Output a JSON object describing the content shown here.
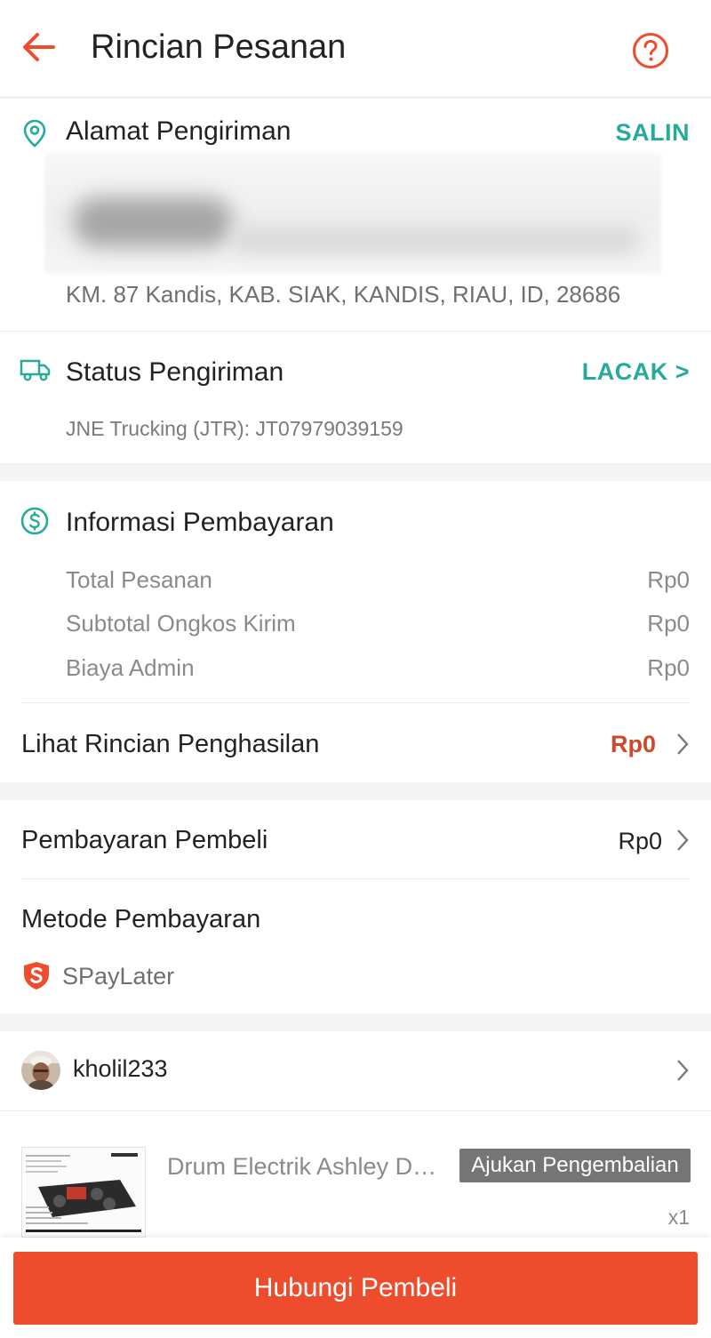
{
  "header": {
    "title": "Rincian Pesanan",
    "back_icon": "arrow-left-icon",
    "help_icon": "question-circle-icon"
  },
  "address": {
    "title": "Alamat Pengiriman",
    "copy_label": "SALIN",
    "line": "KM. 87 Kandis, KAB. SIAK, KANDIS, RIAU, ID, 28686"
  },
  "shipping": {
    "title": "Status Pengiriman",
    "track_label": "LACAK >",
    "carrier": "JNE Trucking (JTR): JT07979039159"
  },
  "payment_info": {
    "title": "Informasi Pembayaran",
    "rows": [
      {
        "label": "Total Pesanan",
        "value": "Rp0"
      },
      {
        "label": "Subtotal Ongkos Kirim",
        "value": "Rp0"
      },
      {
        "label": "Biaya Admin",
        "value": "Rp0"
      }
    ],
    "income_label": "Lihat Rincian Penghasilan",
    "income_value": "Rp0"
  },
  "buyer_payment": {
    "label": "Pembayaran Pembeli",
    "value": "Rp0",
    "method_title": "Metode Pembayaran",
    "method_name": "SPayLater"
  },
  "buyer": {
    "username": "kholil233"
  },
  "product": {
    "name": "Drum Electrik Ashley DM...",
    "return_label": "Ajukan Pengembalian",
    "quantity": "x1"
  },
  "footer": {
    "contact_label": "Hubungi Pembeli"
  },
  "colors": {
    "brand": "#ee4d2d",
    "teal": "#26aa99",
    "income": "#d0482a"
  }
}
